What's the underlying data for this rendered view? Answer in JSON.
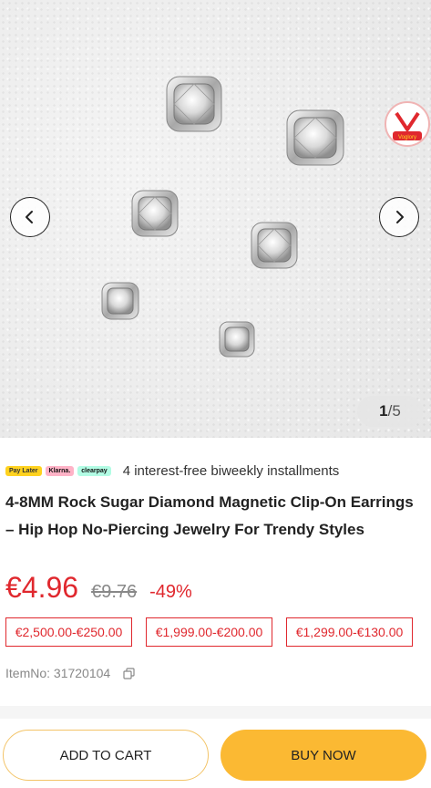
{
  "gallery": {
    "counter_current": "1",
    "counter_separator": "/",
    "counter_total": "5",
    "badge_label": "Voglory"
  },
  "payment": {
    "logos": [
      "Pay Later",
      "Klarna.",
      "clearpay"
    ],
    "text": "4 interest-free biweekly installments"
  },
  "product": {
    "title": "4-8MM Rock Sugar Diamond Magnetic Clip-On Earrings – Hip Hop No-Piercing Jewelry For Trendy Styles",
    "price": "€4.96",
    "original_price": "€9.76",
    "discount": "-49%",
    "coupons": [
      "€2,500.00-€250.00",
      "€1,999.00-€200.00",
      "€1,299.00-€130.00"
    ],
    "item_no": "ItemNo: 31720104"
  },
  "actions": {
    "add_to_cart": "ADD TO CART",
    "buy_now": "BUY NOW"
  },
  "colors": {
    "price_red": "#e0282e",
    "buy_button": "#fbb933",
    "cart_border": "#f3c468"
  }
}
